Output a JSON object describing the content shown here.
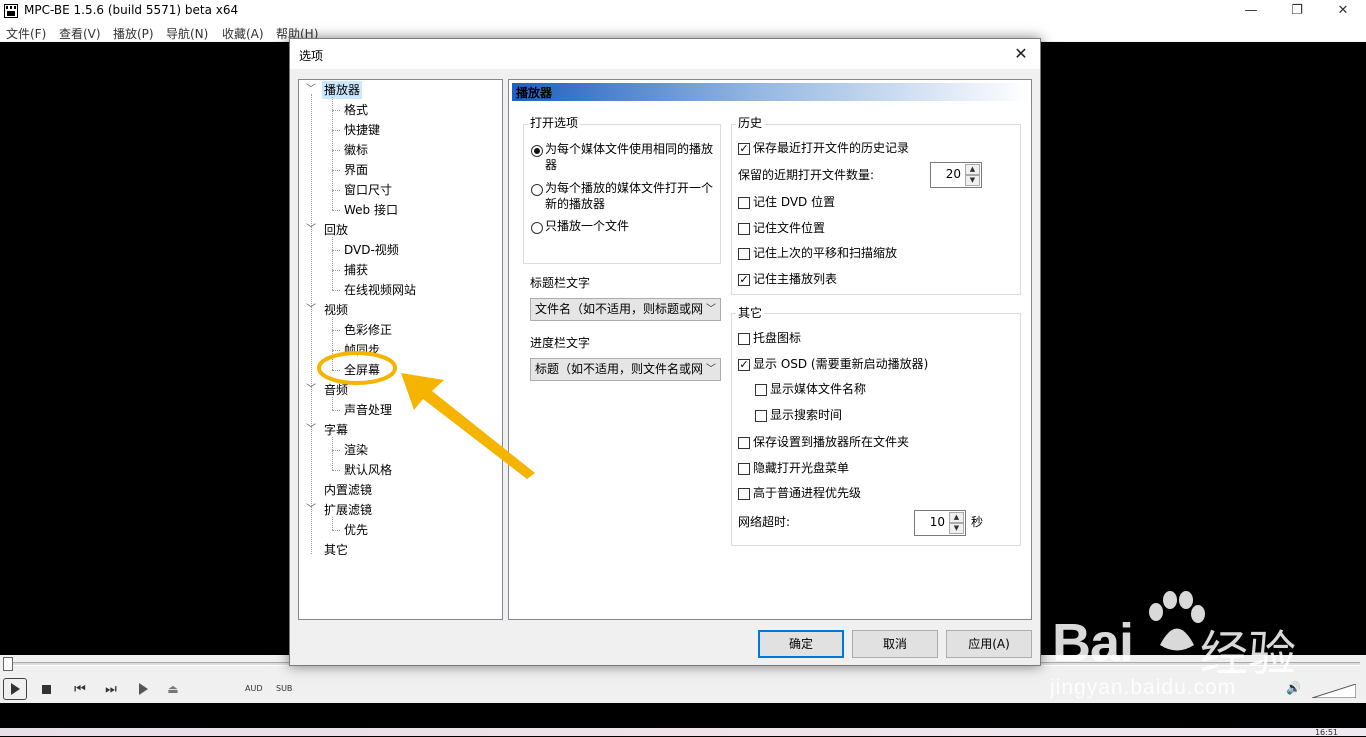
{
  "app": {
    "title": "MPC-BE 1.5.6 (build 5571) beta x64",
    "menu": [
      "文件(F)",
      "查看(V)",
      "播放(P)",
      "导航(N)",
      "收藏(A)",
      "帮助(H)"
    ],
    "controls": {
      "aud": "AUD",
      "sub": "SUB",
      "clock": "16:51"
    }
  },
  "dialog": {
    "title": "选项",
    "tree": [
      {
        "label": "播放器",
        "level": 0,
        "expanded": true,
        "selected": true
      },
      {
        "label": "格式",
        "level": 1
      },
      {
        "label": "快捷键",
        "level": 1
      },
      {
        "label": "徽标",
        "level": 1
      },
      {
        "label": "界面",
        "level": 1
      },
      {
        "label": "窗口尺寸",
        "level": 1
      },
      {
        "label": "Web 接口",
        "level": 1
      },
      {
        "label": "回放",
        "level": 0,
        "expanded": true
      },
      {
        "label": "DVD-视频",
        "level": 1
      },
      {
        "label": "捕获",
        "level": 1
      },
      {
        "label": "在线视频网站",
        "level": 1
      },
      {
        "label": "视频",
        "level": 0,
        "expanded": true
      },
      {
        "label": "色彩修正",
        "level": 1
      },
      {
        "label": "帧同步",
        "level": 1
      },
      {
        "label": "全屏幕",
        "level": 1
      },
      {
        "label": "音频",
        "level": 0,
        "expanded": true
      },
      {
        "label": "声音处理",
        "level": 1
      },
      {
        "label": "字幕",
        "level": 0,
        "expanded": true
      },
      {
        "label": "渲染",
        "level": 1
      },
      {
        "label": "默认风格",
        "level": 1
      },
      {
        "label": "内置滤镜",
        "level": 0
      },
      {
        "label": "扩展滤镜",
        "level": 0,
        "expanded": true
      },
      {
        "label": "优先",
        "level": 1
      },
      {
        "label": "其它",
        "level": 0
      }
    ],
    "page_header": "播放器",
    "open_options": {
      "label": "打开选项",
      "options": [
        {
          "line1": "为每个媒体文件使用相同的播放",
          "line2": "器",
          "checked": true
        },
        {
          "line1": "为每个播放的媒体文件打开一个",
          "line2": "新的播放器",
          "checked": false
        },
        {
          "line1": "只播放一个文件",
          "line2": "",
          "checked": false
        }
      ]
    },
    "title_bar_text": {
      "label": "标题栏文字",
      "value": "文件名（如不适用，则标题或网"
    },
    "progress_bar_text": {
      "label": "进度栏文字",
      "value": "标题（如不适用，则文件名或网"
    },
    "history": {
      "label": "历史",
      "save_recent": {
        "label": "保存最近打开文件的历史记录",
        "checked": true
      },
      "recent_count_label": "保留的近期打开文件数量:",
      "recent_count": "20",
      "remember_dvd": {
        "label": "记住 DVD 位置",
        "checked": false
      },
      "remember_file": {
        "label": "记住文件位置",
        "checked": false
      },
      "remember_pan": {
        "label": "记住上次的平移和扫描缩放",
        "checked": false
      },
      "remember_playlist": {
        "label": "记住主播放列表",
        "checked": true
      }
    },
    "other": {
      "label": "其它",
      "tray_icon": {
        "label": "托盘图标",
        "checked": false
      },
      "show_osd": {
        "label": "显示 OSD (需要重新启动播放器)",
        "checked": true
      },
      "show_filename": {
        "label": "显示媒体文件名称",
        "checked": false
      },
      "show_seektime": {
        "label": "显示搜索时间",
        "checked": false
      },
      "save_to_folder": {
        "label": "保存设置到播放器所在文件夹",
        "checked": false
      },
      "hide_disc_menu": {
        "label": "隐藏打开光盘菜单",
        "checked": false
      },
      "high_priority": {
        "label": "高于普通进程优先级",
        "checked": false
      },
      "timeout_label": "网络超时:",
      "timeout_value": "10",
      "timeout_unit": "秒"
    },
    "buttons": {
      "ok": "确定",
      "cancel": "取消",
      "apply": "应用(A)"
    }
  },
  "watermark": {
    "brand": "Bai",
    "brand2": "经验",
    "url": "jingyan.baidu.com"
  },
  "colors": {
    "annotation": "#f5b400",
    "accent": "#0078d7"
  }
}
